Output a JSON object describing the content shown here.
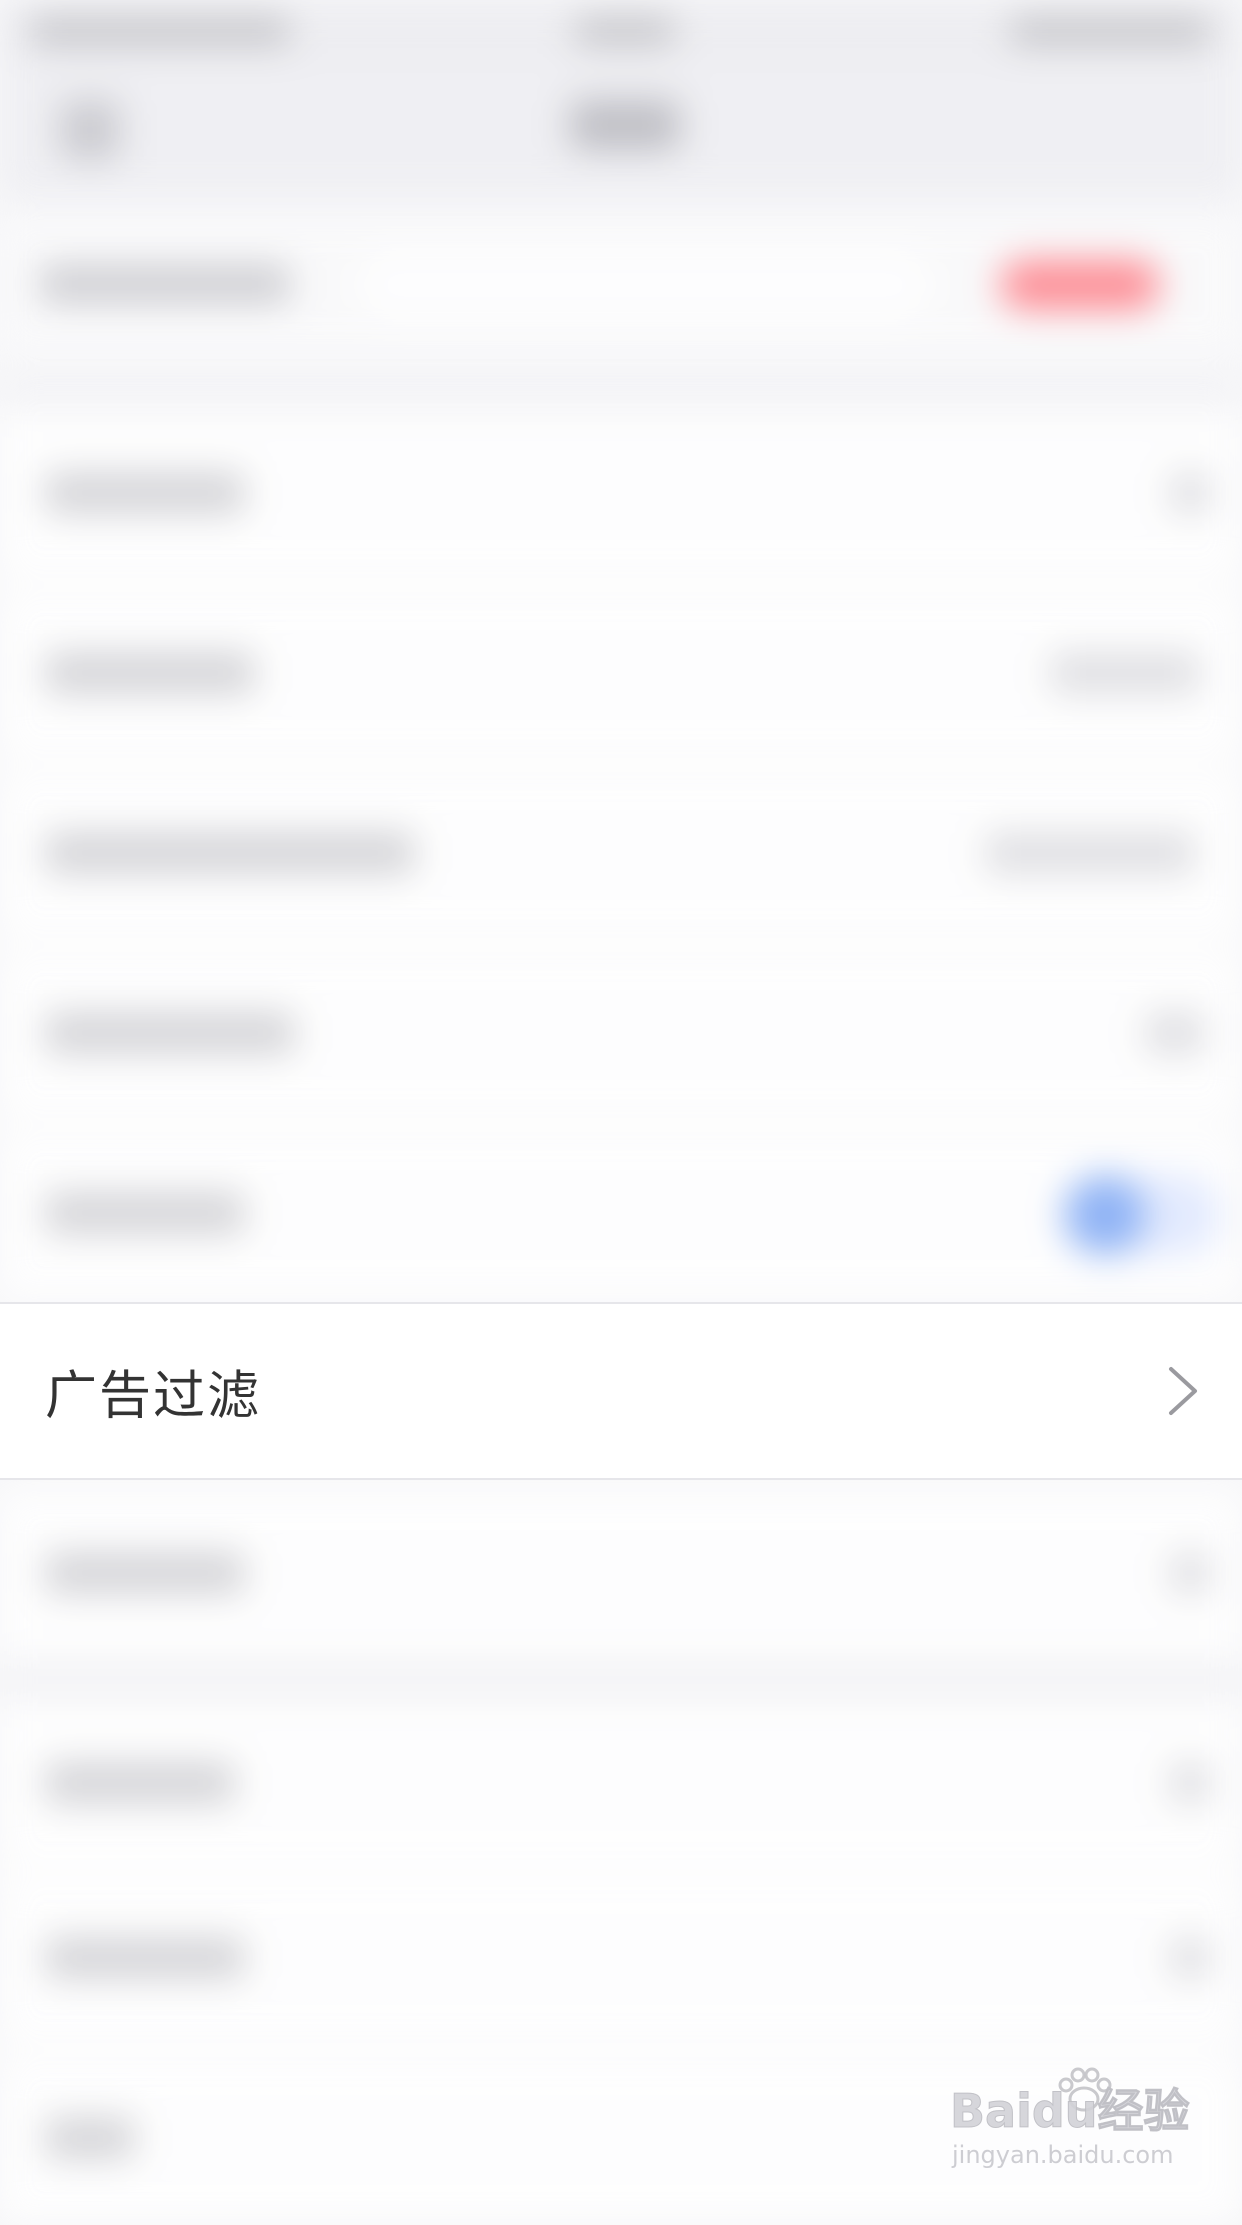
{
  "settings": {
    "ad_filter": {
      "label": "广告过滤"
    }
  },
  "watermark": {
    "brand": "Baidu经验",
    "url": "jingyan.baidu.com"
  },
  "colors": {
    "accent_red": "#ff7d86",
    "toggle_blue": "#7ea8f5",
    "text_primary": "#333333",
    "chevron": "#9a9a9f"
  },
  "icons": {
    "row_chevron": "chevron-right-icon",
    "watermark_logo": "baidu-paw-icon"
  }
}
